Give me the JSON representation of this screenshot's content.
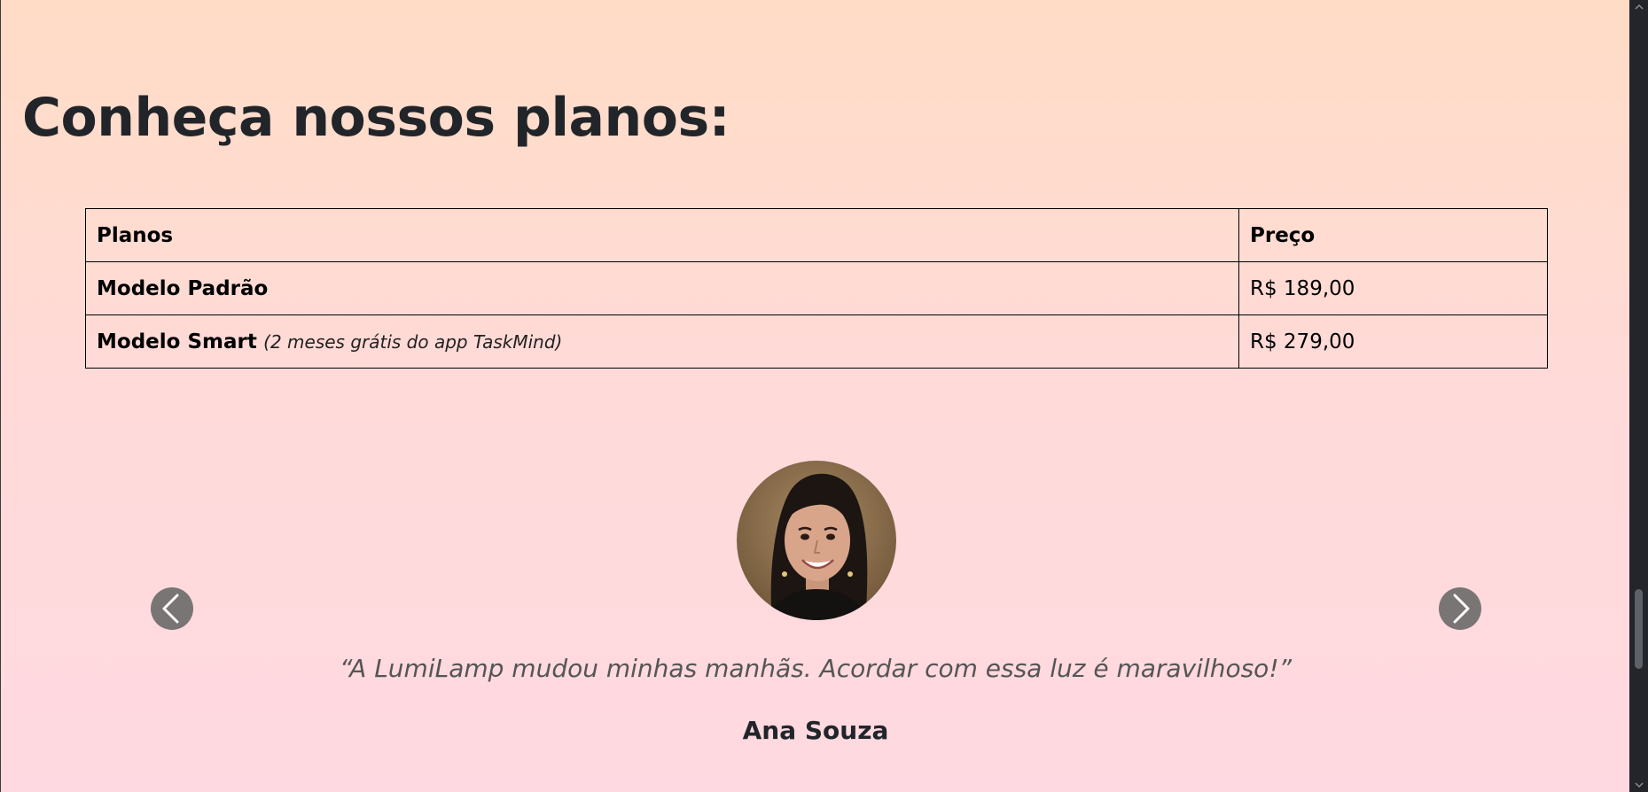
{
  "section": {
    "title": "Conheça nossos planos:"
  },
  "plans_table": {
    "headers": [
      "Planos",
      "Preço"
    ],
    "rows": [
      {
        "name": "Modelo Padrão",
        "note": "",
        "price": "R$ 189,00"
      },
      {
        "name": "Modelo Smart",
        "note": "(2 meses grátis do app TaskMind)",
        "price": "R$ 279,00"
      }
    ]
  },
  "testimonial": {
    "quote": "“A LumiLamp mudou minhas manhãs. Acordar com essa luz é maravilhoso!”",
    "author": "Ana Souza",
    "avatar_icon": "person-photo",
    "prev_icon": "chevron-left-icon",
    "next_icon": "chevron-right-icon"
  },
  "colors": {
    "heading": "#212529",
    "nav_button": "#7a7575",
    "quote_text": "#555555",
    "scrollbar_track": "#23252b",
    "scrollbar_thumb": "#5d6068"
  }
}
